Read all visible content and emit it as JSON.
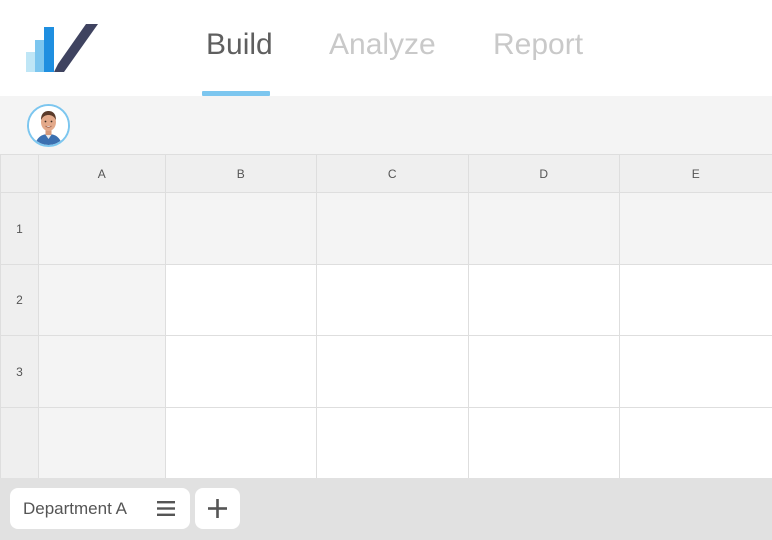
{
  "app": {
    "logo_icon": "bar-chart-check-logo",
    "accent_color": "#7cc6ef"
  },
  "nav": {
    "tabs": [
      {
        "label": "Build",
        "active": true
      },
      {
        "label": "Analyze",
        "active": false
      },
      {
        "label": "Report",
        "active": false
      }
    ]
  },
  "toolbar": {
    "avatar_icon": "user-avatar"
  },
  "grid": {
    "columns": [
      "A",
      "B",
      "C",
      "D",
      "E"
    ],
    "rows": [
      "1",
      "2",
      "3",
      ""
    ]
  },
  "bottom": {
    "sheet_tab_label": "Department A",
    "menu_icon": "hamburger-menu-icon",
    "add_icon": "plus-icon"
  }
}
